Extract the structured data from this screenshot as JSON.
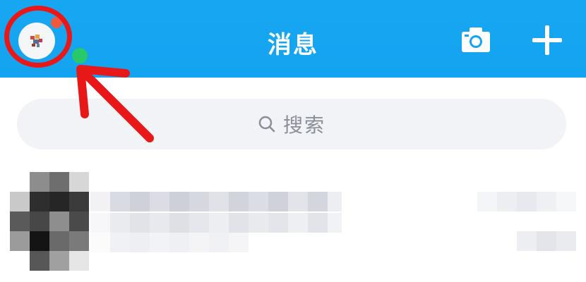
{
  "header": {
    "title": "消息",
    "background_color": "#14a3f0"
  },
  "search": {
    "placeholder": "搜索"
  },
  "annotation": {
    "highlight_color": "#e81818"
  },
  "icons": {
    "avatar": "avatar-icon",
    "camera": "camera-icon",
    "plus": "plus-icon",
    "search": "search-icon"
  }
}
